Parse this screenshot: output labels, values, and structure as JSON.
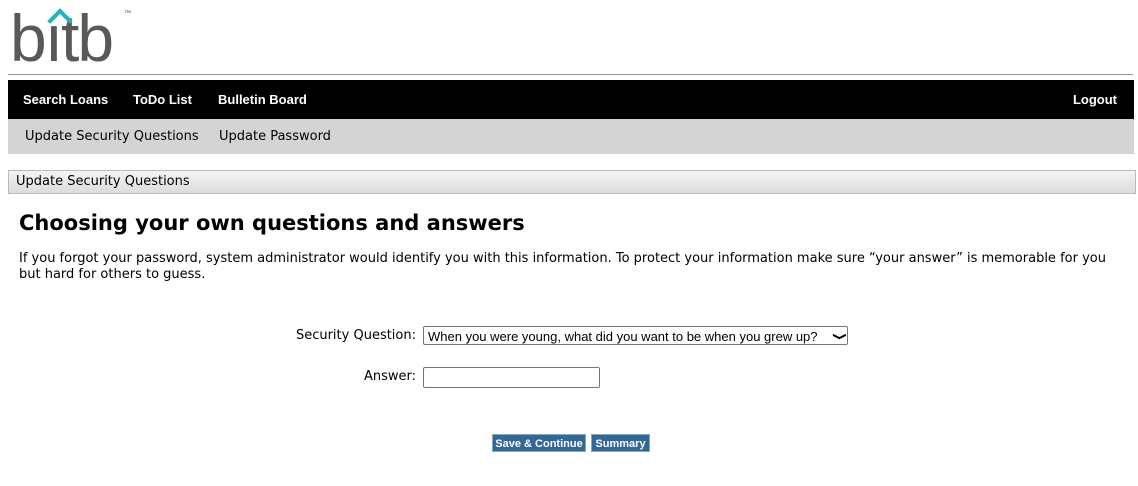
{
  "logo": {
    "text": "bitb",
    "tm": "™"
  },
  "nav": {
    "items": [
      "Search Loans",
      "ToDo List",
      "Bulletin Board"
    ],
    "logout": "Logout"
  },
  "subnav": {
    "items": [
      "Update Security Questions",
      "Update Password"
    ]
  },
  "section_title": "Update Security Questions",
  "heading": "Choosing your own questions and answers",
  "intro": "If you forgot your password, system administrator would identify you with this information. To protect your information make sure “your answer” is memorable for you but hard for others to guess.",
  "form": {
    "question_label": "Security Question:",
    "question_value": "When you were young, what did you want to be when you grew up?",
    "answer_label": "Answer:",
    "answer_value": ""
  },
  "buttons": {
    "save": "Save & Continue",
    "summary": "Summary"
  },
  "colors": {
    "accent": "#336699",
    "logo_teal": "#1fb5c1"
  }
}
